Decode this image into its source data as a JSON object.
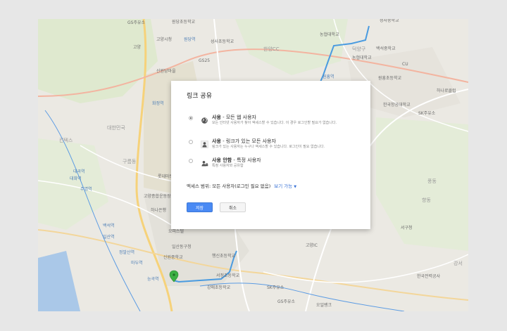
{
  "dialog": {
    "title": "링크 공유",
    "options": [
      {
        "icon": "globe-icon",
        "title_bold": "사용",
        "title_rest": " - 모든 웹 사용자",
        "description": "모든 인터넷 사용자가 찾아 액세스할 수 있습니다. 이 경우 로그인할 필요가 없습니다.",
        "selected": true
      },
      {
        "icon": "person-link-icon",
        "title_bold": "사용",
        "title_rest": " - 링크가 있는 모든 사용자",
        "description": "링크가 있는 사용자는 누구나 액세스할 수 있습니다. 로그인이 필요 없습니다.",
        "selected": false
      },
      {
        "icon": "person-lock-icon",
        "title_bold": "사용 안함",
        "title_rest": " - 특정 사용자",
        "description": "특정 사용자와 공유함",
        "selected": false
      }
    ],
    "scope_text": "액세스 범위: 모든 사용자(로그인 필요 없음)",
    "scope_link": "보기 가능",
    "save_label": "저장",
    "cancel_label": "취소"
  },
  "colors": {
    "primary_button": "#4a8af4",
    "link": "#3a73d6",
    "route": "#4a9be0",
    "rail": "#5b9be3"
  },
  "map": {
    "labels": [
      "GS주유소",
      "원당초등학교",
      "고양시청",
      "원당역",
      "성사초등학교",
      "한양CC",
      "농협대학교",
      "성사중학교",
      "백석중학교",
      "고양",
      "신원당마을",
      "원흥역",
      "CU",
      "화정역",
      "농협대학교",
      "GS25",
      "덕양구",
      "원흥초등학교",
      "한국항공대학교",
      "하나로클럽",
      "대한민국",
      "SK주유소",
      "대곡역",
      "백석역",
      "롯데마트",
      "고양종합운동장",
      "킨텍스",
      "일산역",
      "하나은행",
      "대화역",
      "주엽역",
      "오피스텔",
      "구름동",
      "풍동",
      "서구청",
      "향동",
      "능곡역",
      "정발산역",
      "마두역",
      "일산동구청",
      "신원중학교",
      "행신초등학교",
      "강서",
      "한국전력공사",
      "SK주유소",
      "서정초등학교",
      "강매초등학교",
      "GS주유소",
      "오일뱅크",
      "고양IC"
    ]
  }
}
